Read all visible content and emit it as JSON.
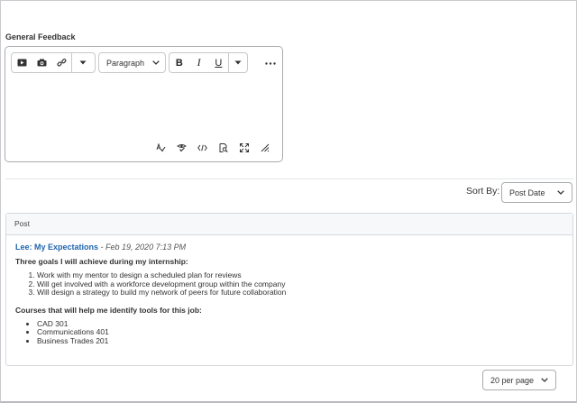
{
  "feedback": {
    "label": "General Feedback",
    "paragraph_select": "Paragraph",
    "bold": "B",
    "italic": "I",
    "underline": "U",
    "more": "•••"
  },
  "sort": {
    "label": "Sort By:",
    "value": "Post Date"
  },
  "table": {
    "header": "Post",
    "post": {
      "title": "Lee: My Expectations",
      "meta": " - Feb 19, 2020 7:13 PM",
      "heading1": "Three goals I will achieve during my internship:",
      "goals": [
        "Work with my mentor to design a scheduled plan for reviews",
        "Will get involved with a workforce development group within the company",
        "Will design a strategy to build my network of peers for future collaboration"
      ],
      "heading2": "Courses that will help me identify tools for this job:",
      "courses": [
        "CAD 301",
        "Communications 401",
        "Business Trades 201"
      ]
    }
  },
  "pagination": {
    "per_page": "20 per page"
  }
}
